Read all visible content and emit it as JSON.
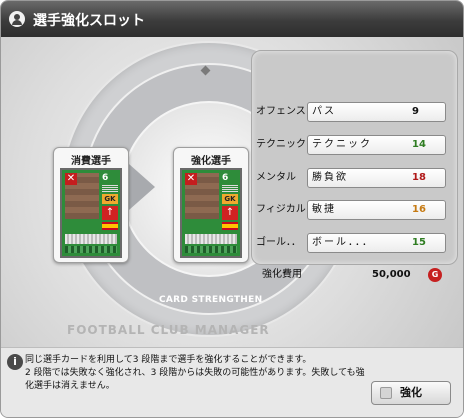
{
  "window": {
    "title": "選手強化スロット"
  },
  "stage": {
    "watermark": "FOOTBALL CLUB MANAGER",
    "brand": "CARD STRENGTHEN"
  },
  "panels": {
    "consume_title": "消費選手",
    "strengthen_title": "強化選手"
  },
  "card": {
    "number": "6",
    "position": "GK",
    "upgrade": "↑",
    "remove": "✕"
  },
  "rows": [
    {
      "label": "オフェンス",
      "value": "パス",
      "num": "9",
      "num_color": "#111111"
    },
    {
      "label": "テクニック",
      "value": "テクニック",
      "num": "14",
      "num_color": "#2f7d22"
    },
    {
      "label": "メンタル",
      "value": "勝負欲",
      "num": "18",
      "num_color": "#b01818"
    },
    {
      "label": "フィジカル",
      "value": "敏捷",
      "num": "16",
      "num_color": "#c67a12"
    },
    {
      "label": "ゴール．．",
      "value": "ボール．．．",
      "num": "15",
      "num_color": "#2f7d22"
    }
  ],
  "cost": {
    "label": "強化費用",
    "value": "50,000",
    "icon": "G"
  },
  "info": {
    "line1": "同じ選手カードを利用して3 段階まで選手を強化することができます。",
    "line2": "2 段階では失敗なく強化され、3 段階からは失敗の可能性があります。失敗しても強",
    "line3": "化選手は消えません。"
  },
  "button": {
    "label": "強化"
  }
}
